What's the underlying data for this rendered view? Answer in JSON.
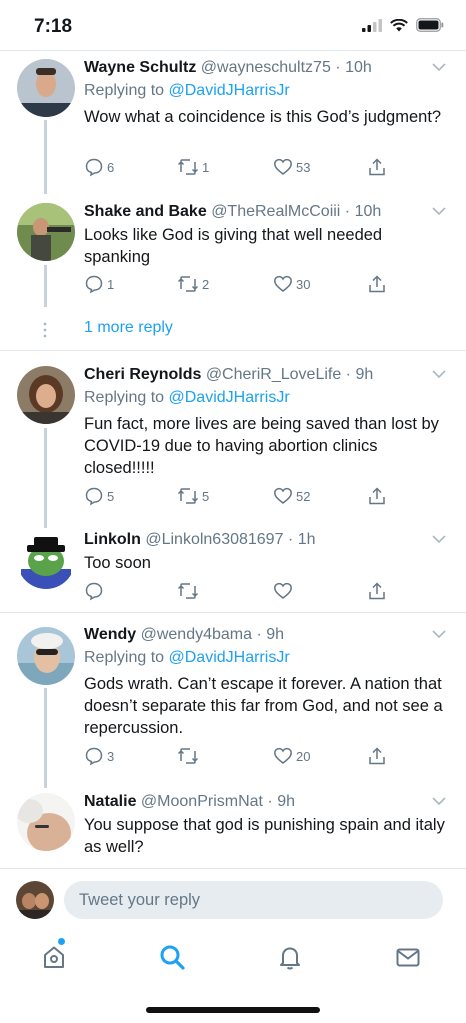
{
  "status": {
    "time": "7:18"
  },
  "tweets": [
    {
      "name": "Wayne Schultz",
      "handle": "@wayneschultz75 · 10h",
      "replying_prefix": "Replying to ",
      "replying_to": "@DavidJHarrisJr",
      "text": "Wow what a coincidence is this God’s judgment?",
      "replies": "6",
      "retweets": "1",
      "likes": "53"
    },
    {
      "name": "Shake and Bake",
      "handle": "@TheRealMcCoiii · 10h",
      "text": "Looks like God is giving that well needed spanking",
      "replies": "1",
      "retweets": "2",
      "likes": "30"
    },
    {
      "name": "Cheri Reynolds",
      "handle": "@CheriR_LoveLife · 9h",
      "replying_prefix": "Replying to ",
      "replying_to": "@DavidJHarrisJr",
      "text": "Fun fact, more lives are being saved than lost by COVID-19 due to having abortion clinics closed!!!!!",
      "replies": "5",
      "retweets": "5",
      "likes": "52"
    },
    {
      "name": "Linkoln",
      "handle": "@Linkoln63081697 · 1h",
      "text": "Too soon",
      "replies": "",
      "retweets": "",
      "likes": ""
    },
    {
      "name": "Wendy",
      "handle": "@wendy4bama · 9h",
      "replying_prefix": "Replying to ",
      "replying_to": "@DavidJHarrisJr",
      "text": "Gods wrath. Can’t escape it forever. A nation that doesn’t separate this far from God, and not see a repercussion.",
      "replies": "3",
      "retweets": "",
      "likes": "20"
    },
    {
      "name": "Natalie",
      "handle": "@MoonPrismNat · 9h",
      "text": "You suppose that god is punishing spain and italy as well?"
    }
  ],
  "more_reply": "1 more reply",
  "composer": {
    "placeholder": "Tweet your reply"
  },
  "tabs": [
    "home-icon",
    "search-icon",
    "notifications-icon",
    "messages-icon"
  ],
  "colors": {
    "accent": "#1da1f2",
    "muted": "#657786",
    "text": "#14171a"
  }
}
